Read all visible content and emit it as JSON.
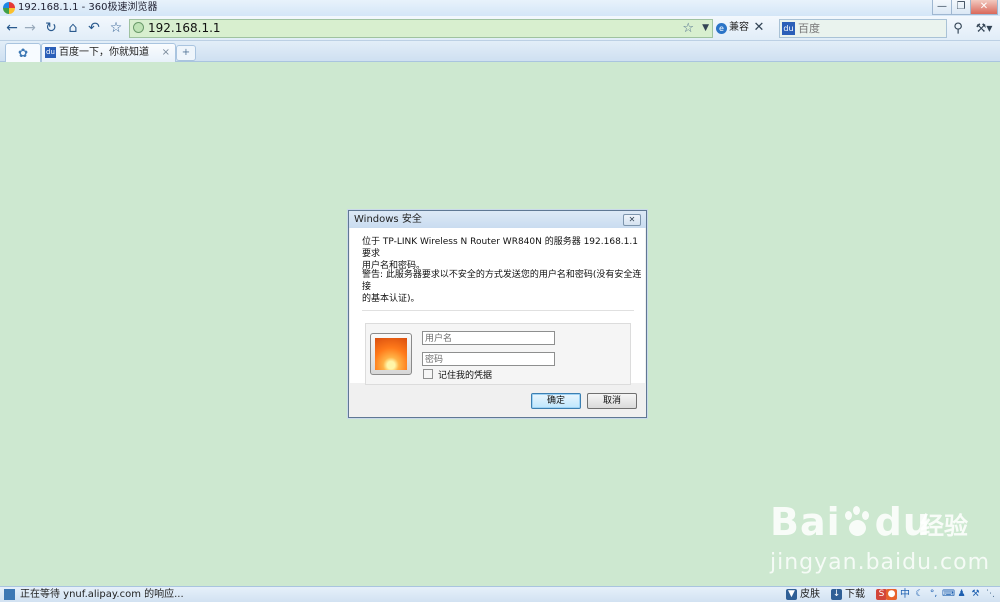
{
  "window": {
    "title": "192.168.1.1 - 360极速浏览器",
    "controls": [
      "—",
      "❐",
      "✕"
    ]
  },
  "toolbar": {
    "url": "192.168.1.1",
    "compat_label": "兼容",
    "search_placeholder": "百度"
  },
  "tabs": [
    {
      "label": "百度一下，你就知道",
      "close": "×"
    }
  ],
  "dialog": {
    "title": "Windows 安全",
    "message_line1": "位于 TP-LINK Wireless N Router WR840N 的服务器 192.168.1.1 要求",
    "message_line2": "用户名和密码。",
    "warning_line1": "警告: 此服务器要求以不安全的方式发送您的用户名和密码(没有安全连接",
    "warning_line2": "的基本认证)。",
    "username_placeholder": "用户名",
    "password_placeholder": "密码",
    "remember_label": "记住我的凭据",
    "ok_label": "确定",
    "cancel_label": "取消"
  },
  "watermark": {
    "brand": "Bai",
    "brand_tail": "du",
    "brand_cn": "经验",
    "url": "jingyan.baidu.com"
  },
  "statusbar": {
    "text": "正在等待 ynuf.alipay.com 的响应...",
    "skin_label": "皮肤",
    "download_label": "下载",
    "ime_label": "中"
  },
  "colors": {
    "page_background": "#cde8d0",
    "address_background": "#d8efcf"
  }
}
